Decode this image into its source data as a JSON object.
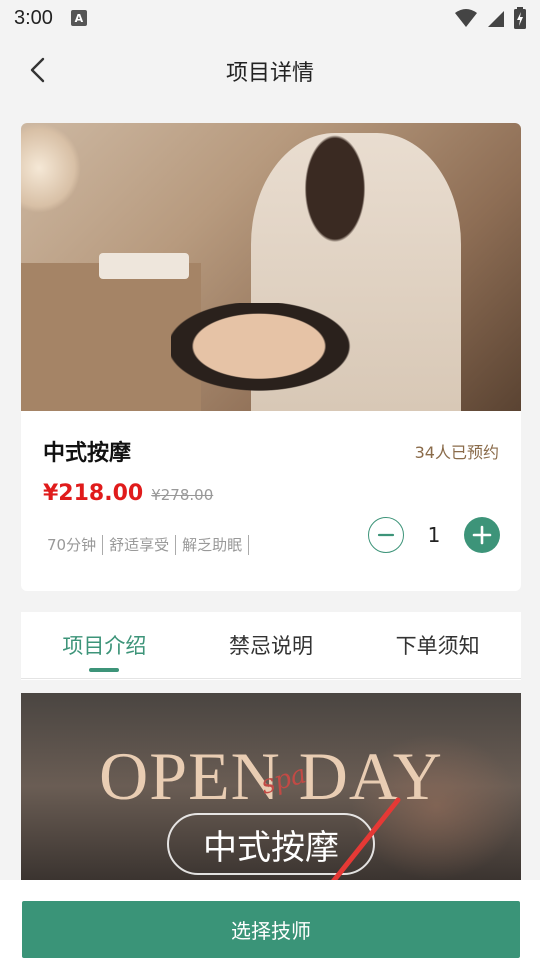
{
  "status_bar": {
    "time": "3:00",
    "app_badge": "A"
  },
  "header": {
    "title": "项目详情"
  },
  "product": {
    "name": "中式按摩",
    "booked": "34人已预约",
    "price_current": "¥218.00",
    "price_original": "¥278.00",
    "tags": [
      "70分钟",
      "舒适享受",
      "解乏助眠"
    ],
    "quantity": "1"
  },
  "tabs": [
    {
      "label": "项目介绍",
      "active": true
    },
    {
      "label": "禁忌说明",
      "active": false
    },
    {
      "label": "下单须知",
      "active": false
    }
  ],
  "banner": {
    "headline": "OPEN DAY",
    "script": "spa",
    "pill_text": "中式按摩"
  },
  "footer": {
    "button_label": "选择技师"
  },
  "colors": {
    "accent": "#3a9478",
    "price": "#e01b1b",
    "booked": "#8a6b4a",
    "annotation_arrow": "#e53935"
  },
  "icons": {
    "back": "chevron-left-icon",
    "minus": "minus-icon",
    "plus": "plus-icon",
    "wifi": "wifi-icon",
    "signal": "signal-icon",
    "battery": "battery-icon"
  }
}
